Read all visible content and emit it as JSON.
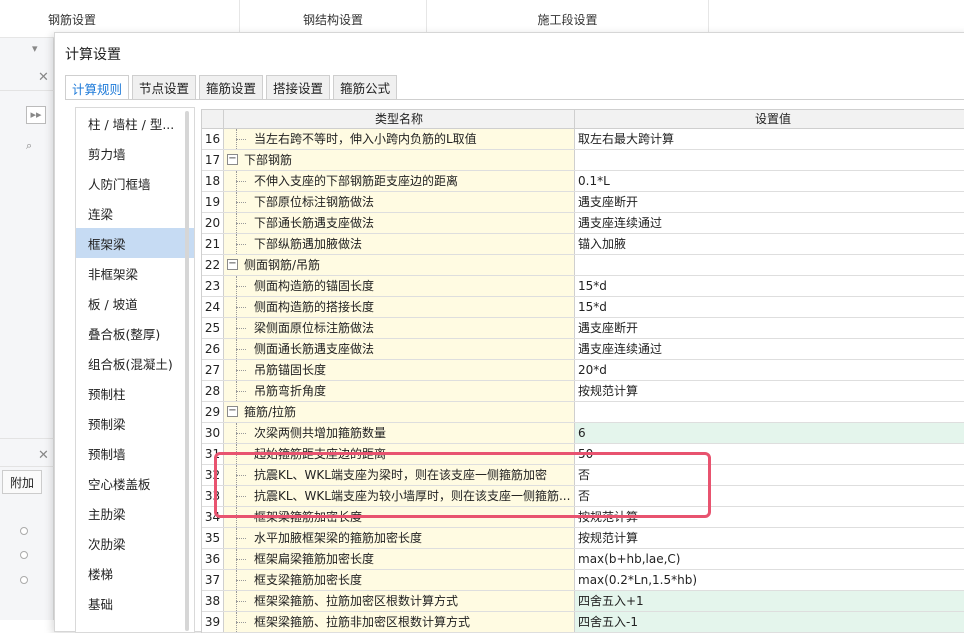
{
  "background": {
    "tabs": [
      "钢筋设置",
      "钢结构设置",
      "施工段设置"
    ],
    "left_button": "附加"
  },
  "dialog": {
    "title": "计算设置",
    "tabs": [
      "计算规则",
      "节点设置",
      "箍筋设置",
      "搭接设置",
      "箍筋公式"
    ],
    "active_tab": "计算规则"
  },
  "categories": [
    "柱 / 墙柱 / 型...",
    "剪力墙",
    "人防门框墙",
    "连梁",
    "框架梁",
    "非框架梁",
    "板 / 坡道",
    "叠合板(整厚)",
    "组合板(混凝土)",
    "预制柱",
    "预制梁",
    "预制墙",
    "空心楼盖板",
    "主肋梁",
    "次肋梁",
    "楼梯",
    "基础"
  ],
  "selected_category": "框架梁",
  "table": {
    "headers": [
      "类型名称",
      "设置值"
    ],
    "rows": [
      {
        "num": "16",
        "name": "当左右跨不等时，伸入小跨内负筋的L取值",
        "value": "取左右最大跨计算",
        "type": "child"
      },
      {
        "num": "17",
        "name": "下部钢筋",
        "value": "",
        "type": "group"
      },
      {
        "num": "18",
        "name": "不伸入支座的下部钢筋距支座边的距离",
        "value": "0.1*L",
        "type": "child"
      },
      {
        "num": "19",
        "name": "下部原位标注钢筋做法",
        "value": "遇支座断开",
        "type": "child"
      },
      {
        "num": "20",
        "name": "下部通长筋遇支座做法",
        "value": "遇支座连续通过",
        "type": "child"
      },
      {
        "num": "21",
        "name": "下部纵筋遇加腋做法",
        "value": "锚入加腋",
        "type": "child"
      },
      {
        "num": "22",
        "name": "侧面钢筋/吊筋",
        "value": "",
        "type": "group"
      },
      {
        "num": "23",
        "name": "侧面构造筋的锚固长度",
        "value": "15*d",
        "type": "child"
      },
      {
        "num": "24",
        "name": "侧面构造筋的搭接长度",
        "value": "15*d",
        "type": "child"
      },
      {
        "num": "25",
        "name": "梁侧面原位标注筋做法",
        "value": "遇支座断开",
        "type": "child"
      },
      {
        "num": "26",
        "name": "侧面通长筋遇支座做法",
        "value": "遇支座连续通过",
        "type": "child"
      },
      {
        "num": "27",
        "name": "吊筋锚固长度",
        "value": "20*d",
        "type": "child"
      },
      {
        "num": "28",
        "name": "吊筋弯折角度",
        "value": "按规范计算",
        "type": "child"
      },
      {
        "num": "29",
        "name": "箍筋/拉筋",
        "value": "",
        "type": "group"
      },
      {
        "num": "30",
        "name": "次梁两侧共增加箍筋数量",
        "value": "6",
        "type": "child",
        "green": true
      },
      {
        "num": "31",
        "name": "起始箍筋距支座边的距离",
        "value": "50",
        "type": "child"
      },
      {
        "num": "32",
        "name": "抗震KL、WKL端支座为梁时，则在该支座一侧箍筋加密",
        "value": "否",
        "type": "child"
      },
      {
        "num": "33",
        "name": "抗震KL、WKL端支座为较小墙厚时，则在该支座一侧箍筋...",
        "value": "否",
        "type": "child"
      },
      {
        "num": "34",
        "name": "框架梁箍筋加密长度",
        "value": "按规范计算",
        "type": "child"
      },
      {
        "num": "35",
        "name": "水平加腋框架梁的箍筋加密长度",
        "value": "按规范计算",
        "type": "child"
      },
      {
        "num": "36",
        "name": "框架扁梁箍筋加密长度",
        "value": "max(b+hb,lae,C)",
        "type": "child"
      },
      {
        "num": "37",
        "name": "框支梁箍筋加密长度",
        "value": "max(0.2*Ln,1.5*hb)",
        "type": "child"
      },
      {
        "num": "38",
        "name": "框架梁箍筋、拉筋加密区根数计算方式",
        "value": "四舍五入+1",
        "type": "child",
        "green": true
      },
      {
        "num": "39",
        "name": "框架梁箍筋、拉筋非加密区根数计算方式",
        "value": "四舍五入-1",
        "type": "child",
        "green": true
      }
    ]
  }
}
